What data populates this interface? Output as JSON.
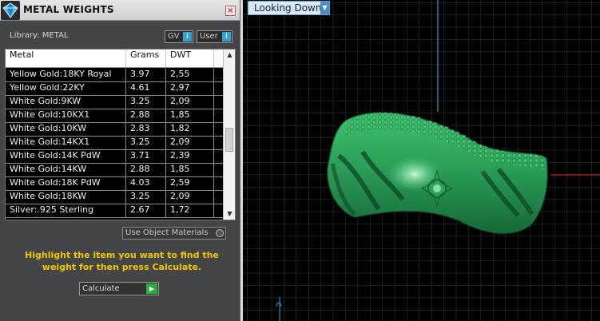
{
  "panel": {
    "title": "METAL WEIGHTS",
    "close_glyph": "×",
    "library_label": "Library: METAL",
    "chips": {
      "gv_label": "GV",
      "user_label": "User",
      "knob_glyph": "I"
    },
    "table": {
      "headers": [
        "Metal",
        "Grams",
        "DWT"
      ],
      "rows": [
        {
          "metal": "Yellow Gold:18KY Royal",
          "grams": "3.97",
          "dwt": "2,55"
        },
        {
          "metal": "Yellow Gold:22KY",
          "grams": "4.61",
          "dwt": "2,97"
        },
        {
          "metal": "White Gold:9KW",
          "grams": "3.25",
          "dwt": "2,09"
        },
        {
          "metal": "White Gold:10KX1",
          "grams": "2.88",
          "dwt": "1,85"
        },
        {
          "metal": "White Gold:10KW",
          "grams": "2.83",
          "dwt": "1,82"
        },
        {
          "metal": "White Gold:14KX1",
          "grams": "3.25",
          "dwt": "2,09"
        },
        {
          "metal": "White Gold:14K PdW",
          "grams": "3.71",
          "dwt": "2,39"
        },
        {
          "metal": "White Gold:14KW",
          "grams": "2.88",
          "dwt": "1,85"
        },
        {
          "metal": "White Gold:18K PdW",
          "grams": "4.03",
          "dwt": "2,59"
        },
        {
          "metal": "White Gold:18KW",
          "grams": "3.25",
          "dwt": "2,09"
        },
        {
          "metal": "Silver:.925 Sterling",
          "grams": "2.67",
          "dwt": "1,72"
        }
      ],
      "scroll_up_glyph": "▲",
      "scroll_down_glyph": "▼"
    },
    "use_object_materials_label": "Use Object Materials",
    "hint_text": "Highlight the item you want to find the weight for then press Calculate.",
    "calculate_label": "Calculate",
    "calculate_glyph": "▶"
  },
  "viewport": {
    "view_label": "Looking Down",
    "view_arrow_glyph": "▼"
  },
  "colors": {
    "hint": "#f2c400",
    "model": "#2e9e58",
    "grid": "#3a3a3a",
    "axis_blue": "#2aa6d8",
    "axis_red": "#d02020",
    "accent_blue": "#3aa0d0",
    "calc_green": "#2eae3e"
  },
  "icons": {
    "logo": "gem-logo-icon",
    "close": "close-icon",
    "dropdown": "chevron-down-icon",
    "calculate": "play-arrow-icon",
    "origin": "origin-axis-icon"
  }
}
